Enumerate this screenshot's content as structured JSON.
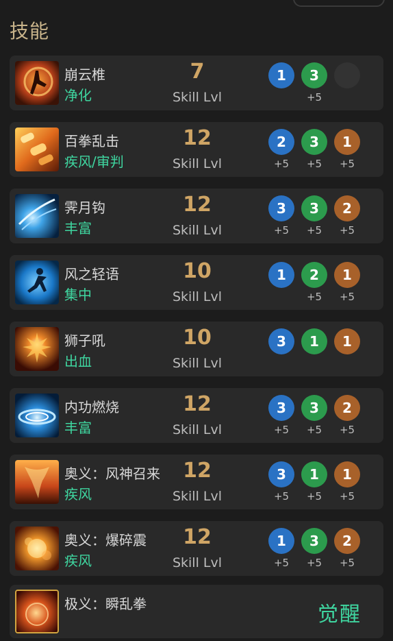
{
  "section_title": "技能",
  "labels": {
    "skill_lvl": "Skill Lvl"
  },
  "colors": {
    "blue": "#2a72c4",
    "green": "#2c9b4d",
    "brown": "#a8612a",
    "tag": "#3fd6a0",
    "level": "#cfa565"
  },
  "skills": [
    {
      "name": "崩云椎",
      "tag": "净化",
      "level": "7",
      "runes": [
        {
          "value": "1",
          "color": "blue",
          "bonus": ""
        },
        {
          "value": "3",
          "color": "green",
          "bonus": "+5"
        },
        {
          "value": "",
          "color": "empty",
          "bonus": ""
        }
      ]
    },
    {
      "name": "百拳乱击",
      "tag": "疾风/审判",
      "level": "12",
      "runes": [
        {
          "value": "2",
          "color": "blue",
          "bonus": "+5"
        },
        {
          "value": "3",
          "color": "green",
          "bonus": "+5"
        },
        {
          "value": "1",
          "color": "brown",
          "bonus": "+5"
        }
      ]
    },
    {
      "name": "霁月钩",
      "tag": "丰富",
      "level": "12",
      "runes": [
        {
          "value": "3",
          "color": "blue",
          "bonus": "+5"
        },
        {
          "value": "3",
          "color": "green",
          "bonus": "+5"
        },
        {
          "value": "2",
          "color": "brown",
          "bonus": "+5"
        }
      ]
    },
    {
      "name": "风之轻语",
      "tag": "集中",
      "level": "10",
      "runes": [
        {
          "value": "1",
          "color": "blue",
          "bonus": ""
        },
        {
          "value": "2",
          "color": "green",
          "bonus": "+5"
        },
        {
          "value": "1",
          "color": "brown",
          "bonus": "+5"
        }
      ]
    },
    {
      "name": "狮子吼",
      "tag": "出血",
      "level": "10",
      "runes": [
        {
          "value": "3",
          "color": "blue",
          "bonus": ""
        },
        {
          "value": "1",
          "color": "green",
          "bonus": ""
        },
        {
          "value": "1",
          "color": "brown",
          "bonus": ""
        }
      ]
    },
    {
      "name": "内功燃烧",
      "tag": "丰富",
      "level": "12",
      "runes": [
        {
          "value": "3",
          "color": "blue",
          "bonus": "+5"
        },
        {
          "value": "3",
          "color": "green",
          "bonus": "+5"
        },
        {
          "value": "2",
          "color": "brown",
          "bonus": "+5"
        }
      ]
    },
    {
      "name": "奥义：风神召来",
      "tag": "疾风",
      "level": "12",
      "runes": [
        {
          "value": "3",
          "color": "blue",
          "bonus": "+5"
        },
        {
          "value": "1",
          "color": "green",
          "bonus": "+5"
        },
        {
          "value": "1",
          "color": "brown",
          "bonus": "+5"
        }
      ]
    },
    {
      "name": "奥义：爆碎震",
      "tag": "疾风",
      "level": "12",
      "runes": [
        {
          "value": "1",
          "color": "blue",
          "bonus": "+5"
        },
        {
          "value": "3",
          "color": "green",
          "bonus": "+5"
        },
        {
          "value": "2",
          "color": "brown",
          "bonus": "+5"
        }
      ]
    }
  ],
  "ultimate": {
    "name": "极义：瞬乱拳",
    "action": "觉醒"
  }
}
